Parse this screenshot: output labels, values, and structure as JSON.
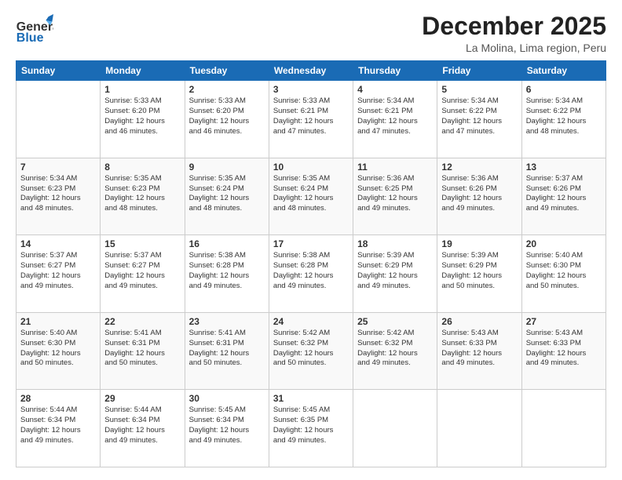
{
  "header": {
    "logo_general": "General",
    "logo_blue": "Blue",
    "month_title": "December 2025",
    "location": "La Molina, Lima region, Peru"
  },
  "calendar": {
    "days_of_week": [
      "Sunday",
      "Monday",
      "Tuesday",
      "Wednesday",
      "Thursday",
      "Friday",
      "Saturday"
    ],
    "weeks": [
      [
        {
          "day": "",
          "info": ""
        },
        {
          "day": "1",
          "info": "Sunrise: 5:33 AM\nSunset: 6:20 PM\nDaylight: 12 hours\nand 46 minutes."
        },
        {
          "day": "2",
          "info": "Sunrise: 5:33 AM\nSunset: 6:20 PM\nDaylight: 12 hours\nand 46 minutes."
        },
        {
          "day": "3",
          "info": "Sunrise: 5:33 AM\nSunset: 6:21 PM\nDaylight: 12 hours\nand 47 minutes."
        },
        {
          "day": "4",
          "info": "Sunrise: 5:34 AM\nSunset: 6:21 PM\nDaylight: 12 hours\nand 47 minutes."
        },
        {
          "day": "5",
          "info": "Sunrise: 5:34 AM\nSunset: 6:22 PM\nDaylight: 12 hours\nand 47 minutes."
        },
        {
          "day": "6",
          "info": "Sunrise: 5:34 AM\nSunset: 6:22 PM\nDaylight: 12 hours\nand 48 minutes."
        }
      ],
      [
        {
          "day": "7",
          "info": "Sunrise: 5:34 AM\nSunset: 6:23 PM\nDaylight: 12 hours\nand 48 minutes."
        },
        {
          "day": "8",
          "info": "Sunrise: 5:35 AM\nSunset: 6:23 PM\nDaylight: 12 hours\nand 48 minutes."
        },
        {
          "day": "9",
          "info": "Sunrise: 5:35 AM\nSunset: 6:24 PM\nDaylight: 12 hours\nand 48 minutes."
        },
        {
          "day": "10",
          "info": "Sunrise: 5:35 AM\nSunset: 6:24 PM\nDaylight: 12 hours\nand 48 minutes."
        },
        {
          "day": "11",
          "info": "Sunrise: 5:36 AM\nSunset: 6:25 PM\nDaylight: 12 hours\nand 49 minutes."
        },
        {
          "day": "12",
          "info": "Sunrise: 5:36 AM\nSunset: 6:26 PM\nDaylight: 12 hours\nand 49 minutes."
        },
        {
          "day": "13",
          "info": "Sunrise: 5:37 AM\nSunset: 6:26 PM\nDaylight: 12 hours\nand 49 minutes."
        }
      ],
      [
        {
          "day": "14",
          "info": "Sunrise: 5:37 AM\nSunset: 6:27 PM\nDaylight: 12 hours\nand 49 minutes."
        },
        {
          "day": "15",
          "info": "Sunrise: 5:37 AM\nSunset: 6:27 PM\nDaylight: 12 hours\nand 49 minutes."
        },
        {
          "day": "16",
          "info": "Sunrise: 5:38 AM\nSunset: 6:28 PM\nDaylight: 12 hours\nand 49 minutes."
        },
        {
          "day": "17",
          "info": "Sunrise: 5:38 AM\nSunset: 6:28 PM\nDaylight: 12 hours\nand 49 minutes."
        },
        {
          "day": "18",
          "info": "Sunrise: 5:39 AM\nSunset: 6:29 PM\nDaylight: 12 hours\nand 49 minutes."
        },
        {
          "day": "19",
          "info": "Sunrise: 5:39 AM\nSunset: 6:29 PM\nDaylight: 12 hours\nand 50 minutes."
        },
        {
          "day": "20",
          "info": "Sunrise: 5:40 AM\nSunset: 6:30 PM\nDaylight: 12 hours\nand 50 minutes."
        }
      ],
      [
        {
          "day": "21",
          "info": "Sunrise: 5:40 AM\nSunset: 6:30 PM\nDaylight: 12 hours\nand 50 minutes."
        },
        {
          "day": "22",
          "info": "Sunrise: 5:41 AM\nSunset: 6:31 PM\nDaylight: 12 hours\nand 50 minutes."
        },
        {
          "day": "23",
          "info": "Sunrise: 5:41 AM\nSunset: 6:31 PM\nDaylight: 12 hours\nand 50 minutes."
        },
        {
          "day": "24",
          "info": "Sunrise: 5:42 AM\nSunset: 6:32 PM\nDaylight: 12 hours\nand 50 minutes."
        },
        {
          "day": "25",
          "info": "Sunrise: 5:42 AM\nSunset: 6:32 PM\nDaylight: 12 hours\nand 49 minutes."
        },
        {
          "day": "26",
          "info": "Sunrise: 5:43 AM\nSunset: 6:33 PM\nDaylight: 12 hours\nand 49 minutes."
        },
        {
          "day": "27",
          "info": "Sunrise: 5:43 AM\nSunset: 6:33 PM\nDaylight: 12 hours\nand 49 minutes."
        }
      ],
      [
        {
          "day": "28",
          "info": "Sunrise: 5:44 AM\nSunset: 6:34 PM\nDaylight: 12 hours\nand 49 minutes."
        },
        {
          "day": "29",
          "info": "Sunrise: 5:44 AM\nSunset: 6:34 PM\nDaylight: 12 hours\nand 49 minutes."
        },
        {
          "day": "30",
          "info": "Sunrise: 5:45 AM\nSunset: 6:34 PM\nDaylight: 12 hours\nand 49 minutes."
        },
        {
          "day": "31",
          "info": "Sunrise: 5:45 AM\nSunset: 6:35 PM\nDaylight: 12 hours\nand 49 minutes."
        },
        {
          "day": "",
          "info": ""
        },
        {
          "day": "",
          "info": ""
        },
        {
          "day": "",
          "info": ""
        }
      ]
    ]
  }
}
